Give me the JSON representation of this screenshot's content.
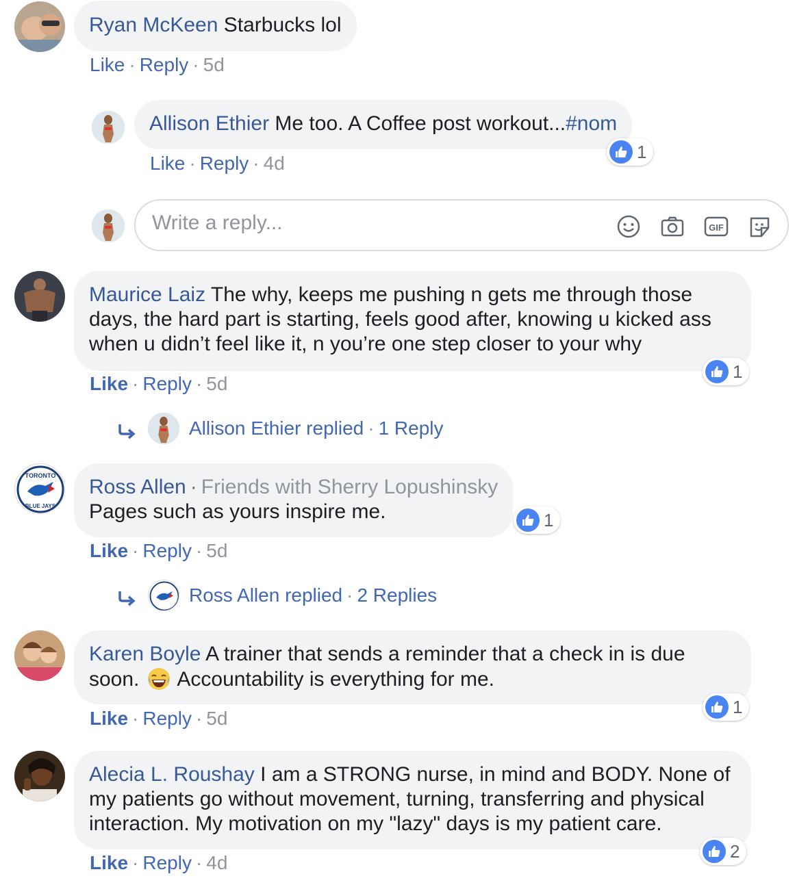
{
  "colors": {
    "link": "#4267b2",
    "name": "#385898",
    "bubble": "#f2f3f5",
    "muted": "#90949c",
    "like_blue": "#4a84f2"
  },
  "comments": [
    {
      "name": "Ryan McKeen",
      "text": "Starbucks lol",
      "like": "Like",
      "reply": "Reply",
      "time": "5d"
    },
    {
      "name": "Allison Ethier",
      "text": "Me too. A Coffee post workout...",
      "hashtag": "#nom",
      "like": "Like",
      "reply": "Reply",
      "time": "4d",
      "reactions": "1"
    },
    {
      "name": "Maurice Laiz",
      "text_lines": [
        "The why, keeps me pushing n gets me through those",
        "days, the hard part is starting, feels good after, knowing u kicked ass",
        "when u didn’t feel like it, n you’re one step closer to your why"
      ],
      "like": "Like",
      "reply": "Reply",
      "time": "5d",
      "reactions": "1",
      "thread": {
        "who": "Allison Ethier replied",
        "count": "1 Reply"
      }
    },
    {
      "name": "Ross Allen",
      "friends": "Friends with Sherry Lopushinsky",
      "text": "Pages such as yours inspire me.",
      "like": "Like",
      "reply": "Reply",
      "time": "5d",
      "reactions": "1",
      "thread": {
        "who": "Ross Allen replied",
        "count": "2 Replies"
      }
    },
    {
      "name": "Karen Boyle",
      "text_line1": "A trainer that sends a reminder that a check in is due",
      "text_line2a": "soon.",
      "text_line2b": "Accountability is everything for me.",
      "like": "Like",
      "reply": "Reply",
      "time": "5d",
      "reactions": "1"
    },
    {
      "name": "Alecia L. Roushay",
      "text_lines": [
        "I am a STRONG nurse, in mind and BODY. None of",
        "my patients go without movement, turning, transferring and physical",
        "interaction. My motivation on my \"lazy\" days is my patient care."
      ],
      "like": "Like",
      "reply": "Reply",
      "time": "4d",
      "reactions": "2"
    }
  ],
  "reply_box": {
    "placeholder": "Write a reply...",
    "gif_label": "GIF"
  },
  "logo": {
    "top": "TORONTO",
    "bottom": "BLUE JAYS"
  },
  "icons": [
    "thumbs-up-icon",
    "smiley-icon",
    "camera-icon",
    "gif-icon",
    "sticker-icon",
    "reply-arrow-icon"
  ]
}
